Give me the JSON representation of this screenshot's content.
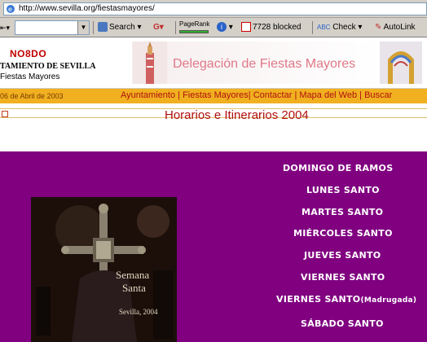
{
  "browser": {
    "url": "http://www.sevilla.org/fiestasmayores/"
  },
  "toolbar": {
    "search_label": "Search",
    "pagerank_label": "PageRank",
    "blocked_label": "7728 blocked",
    "check_label": "Check",
    "autolink_label": "AutoLink"
  },
  "header": {
    "logo_text": "NO8DO",
    "ayuntamiento": "TAMIENTO DE SEVILLA",
    "department": "Fiestas Mayores",
    "banner_title": "Delegación de Fiestas Mayores"
  },
  "nav": {
    "date": "06 de Abril de 2003",
    "links": [
      "Ayuntamiento",
      "Fiestas Mayores",
      "Contactar",
      "Mapa del Web",
      "Buscar"
    ]
  },
  "page_title": "Horarios e Itinerarios 2004",
  "photo": {
    "caption_line1": "Semana",
    "caption_line2": "Santa",
    "caption_line3": "Sevilla, 2004"
  },
  "days": [
    {
      "label": "DOMINGO DE RAMOS"
    },
    {
      "label": "LUNES SANTO"
    },
    {
      "label": "MARTES SANTO"
    },
    {
      "label": "MIÉRCOLES SANTO"
    },
    {
      "label": "JUEVES SANTO"
    },
    {
      "label": "VIERNES SANTO"
    },
    {
      "label": "VIERNES SANTO",
      "suffix": "(Madrugada)"
    },
    {
      "label": "SÁBADO SANTO"
    }
  ],
  "colors": {
    "purple": "#800080",
    "nav_bg": "#f0b020",
    "accent_red": "#b01010"
  }
}
